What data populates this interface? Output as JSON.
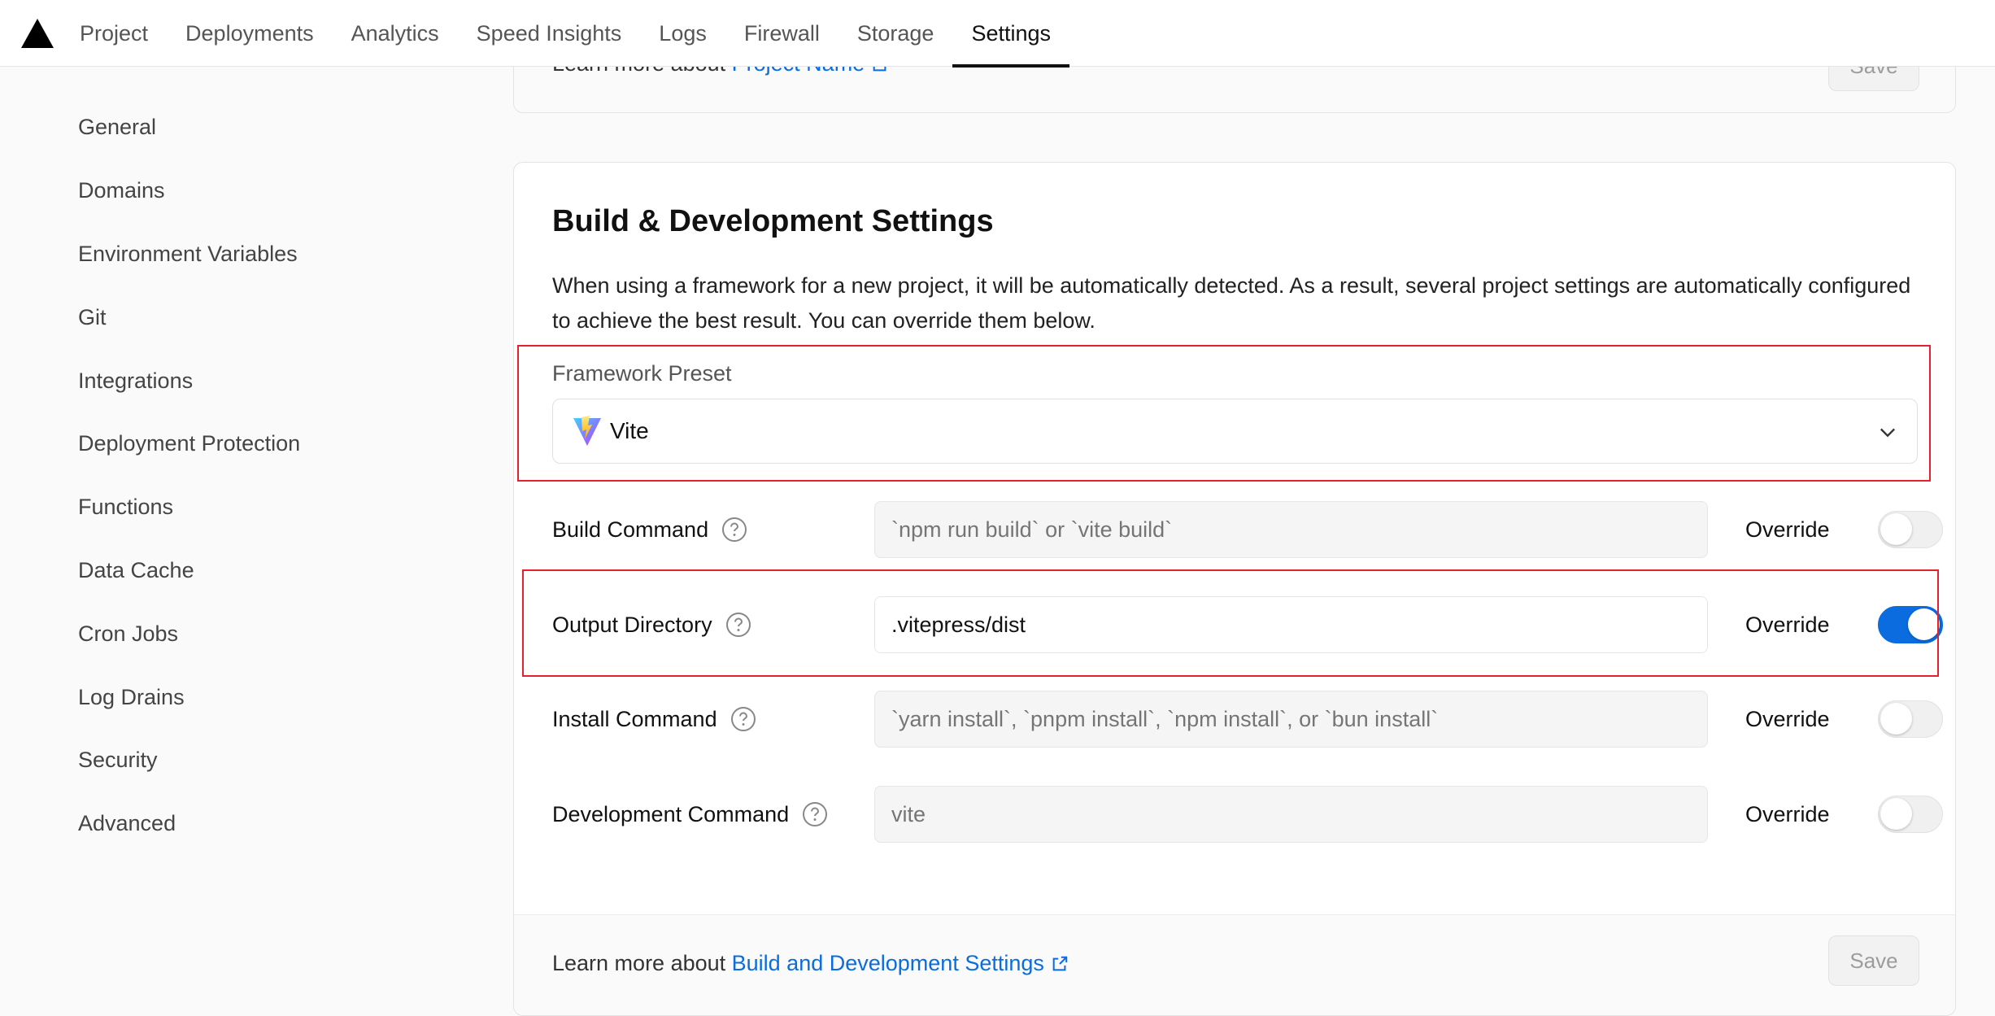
{
  "nav": {
    "tabs": [
      "Project",
      "Deployments",
      "Analytics",
      "Speed Insights",
      "Logs",
      "Firewall",
      "Storage",
      "Settings"
    ],
    "active_tab": "Settings"
  },
  "sidebar": {
    "items": [
      {
        "label": "General"
      },
      {
        "label": "Domains"
      },
      {
        "label": "Environment Variables"
      },
      {
        "label": "Git"
      },
      {
        "label": "Integrations"
      },
      {
        "label": "Deployment Protection"
      },
      {
        "label": "Functions"
      },
      {
        "label": "Data Cache"
      },
      {
        "label": "Cron Jobs"
      },
      {
        "label": "Log Drains"
      },
      {
        "label": "Security"
      },
      {
        "label": "Advanced"
      }
    ]
  },
  "project_name_card": {
    "learn_prefix": "Learn more about ",
    "learn_link": "Project Name",
    "save_label": "Save"
  },
  "build_card": {
    "title": "Build & Development Settings",
    "description": "When using a framework for a new project, it will be automatically detected. As a result, several project settings are automatically configured to achieve the best result. You can override them below.",
    "framework_label": "Framework Preset",
    "framework_value": "Vite",
    "rows": [
      {
        "label": "Build Command",
        "placeholder": "`npm run build` or `vite build`",
        "value": "",
        "override_label": "Override",
        "override_on": false
      },
      {
        "label": "Output Directory",
        "placeholder": "",
        "value": ".vitepress/dist",
        "override_label": "Override",
        "override_on": true
      },
      {
        "label": "Install Command",
        "placeholder": "`yarn install`, `pnpm install`, `npm install`, or `bun install`",
        "value": "",
        "override_label": "Override",
        "override_on": false
      },
      {
        "label": "Development Command",
        "placeholder": "vite",
        "value": "",
        "override_label": "Override",
        "override_on": false
      }
    ],
    "learn_prefix": "Learn more about ",
    "learn_link": "Build and Development Settings",
    "save_label": "Save"
  },
  "colors": {
    "accent": "#0a6cde",
    "highlight": "#e5202f"
  }
}
